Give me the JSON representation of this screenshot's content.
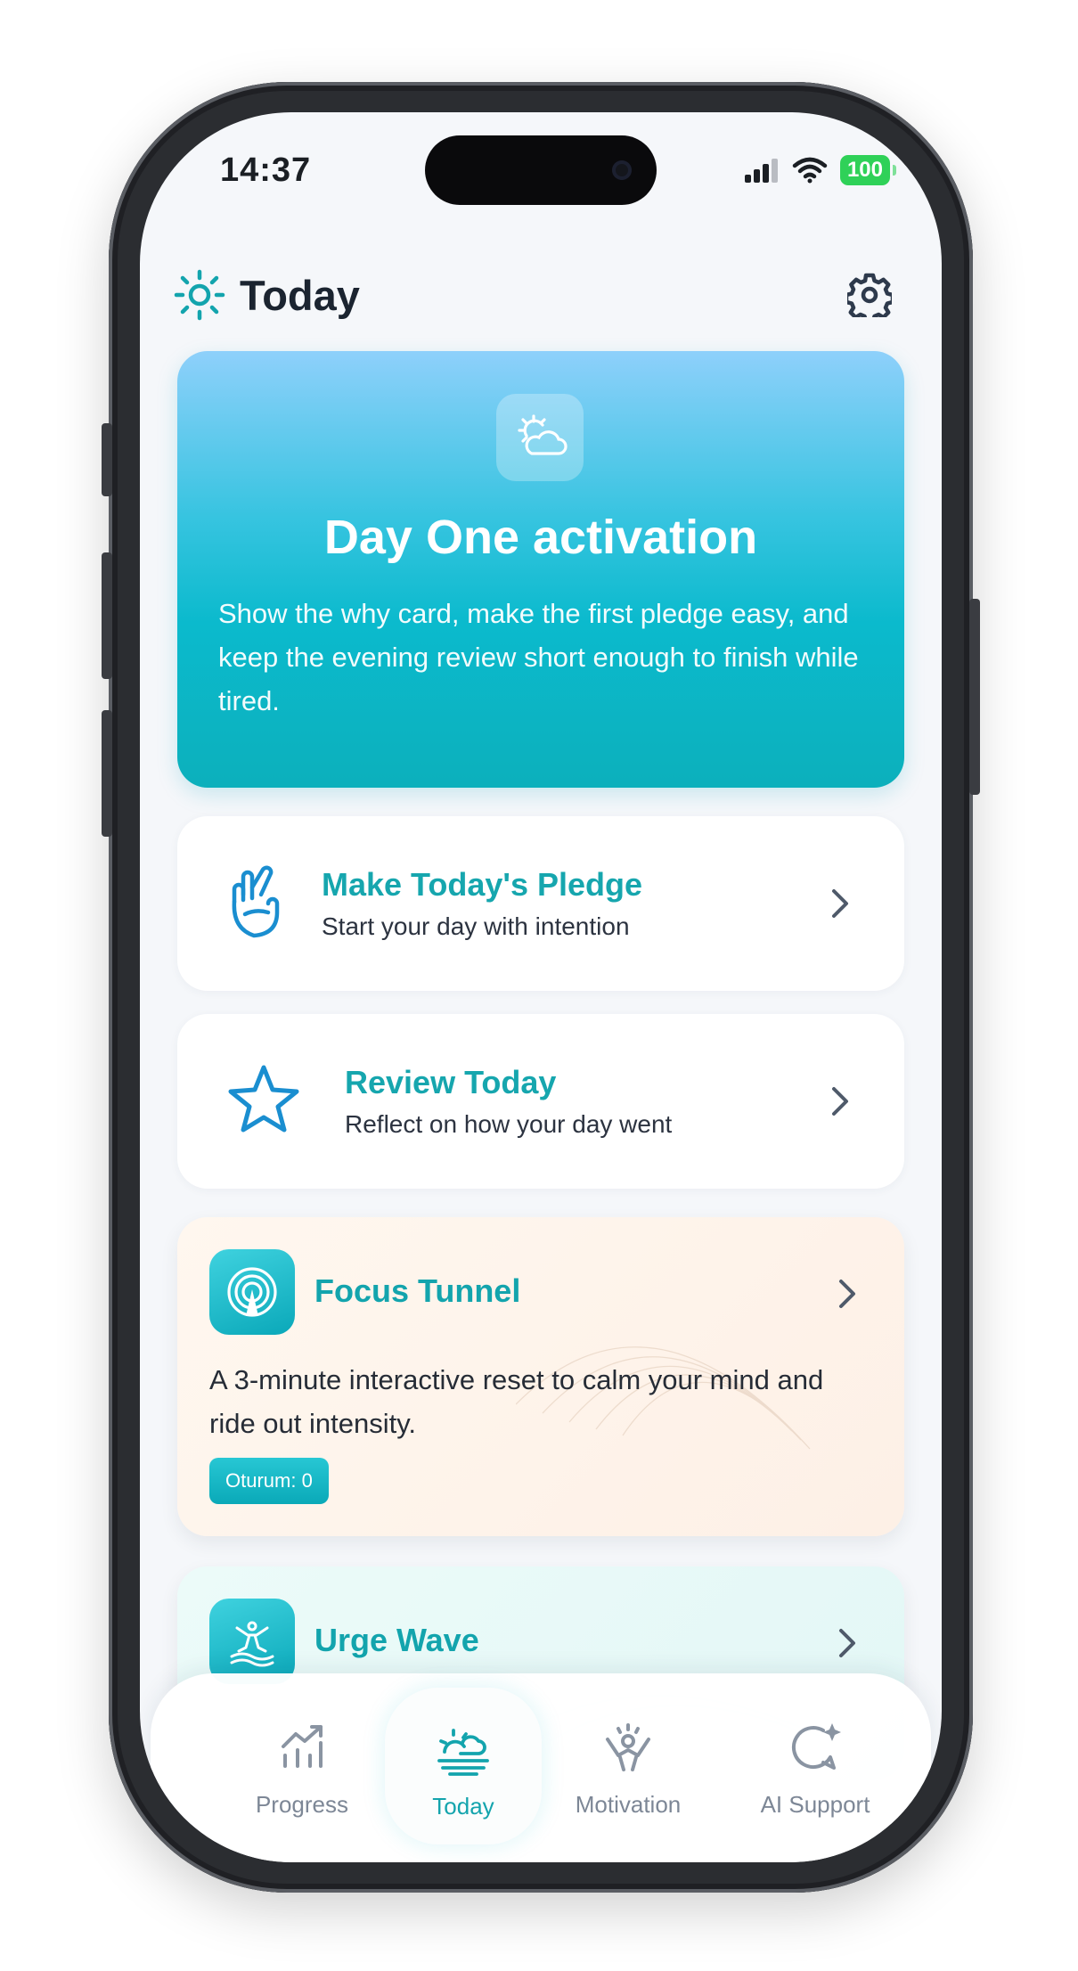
{
  "status_bar": {
    "time": "14:37",
    "battery": "100"
  },
  "header": {
    "title": "Today"
  },
  "hero": {
    "title": "Day One activation",
    "description": "Show the why card, make the first pledge easy, and keep the evening review short enough to finish while tired."
  },
  "actions": [
    {
      "title": "Make Today's Pledge",
      "subtitle": "Start your day with intention"
    },
    {
      "title": "Review Today",
      "subtitle": "Reflect on how your day went"
    }
  ],
  "features": [
    {
      "title": "Focus Tunnel",
      "description": "A 3-minute interactive reset to calm your mind and ride out intensity.",
      "badge": "Oturum: 0"
    },
    {
      "title": "Urge Wave"
    }
  ],
  "nav": {
    "items": [
      {
        "label": "Progress",
        "icon": "chart-icon"
      },
      {
        "label": "Today",
        "icon": "sun-horizon-icon",
        "active": true
      },
      {
        "label": "Motivation",
        "icon": "cheer-icon"
      },
      {
        "label": "AI Support",
        "icon": "chat-sparkle-icon"
      }
    ]
  },
  "colors": {
    "accent": "#13a4ad",
    "hero_top": "#8ed0fb",
    "hero_bottom": "#0cb0bc",
    "focus_bg": "#fff7ef",
    "urge_bg": "#ecfbf9"
  }
}
